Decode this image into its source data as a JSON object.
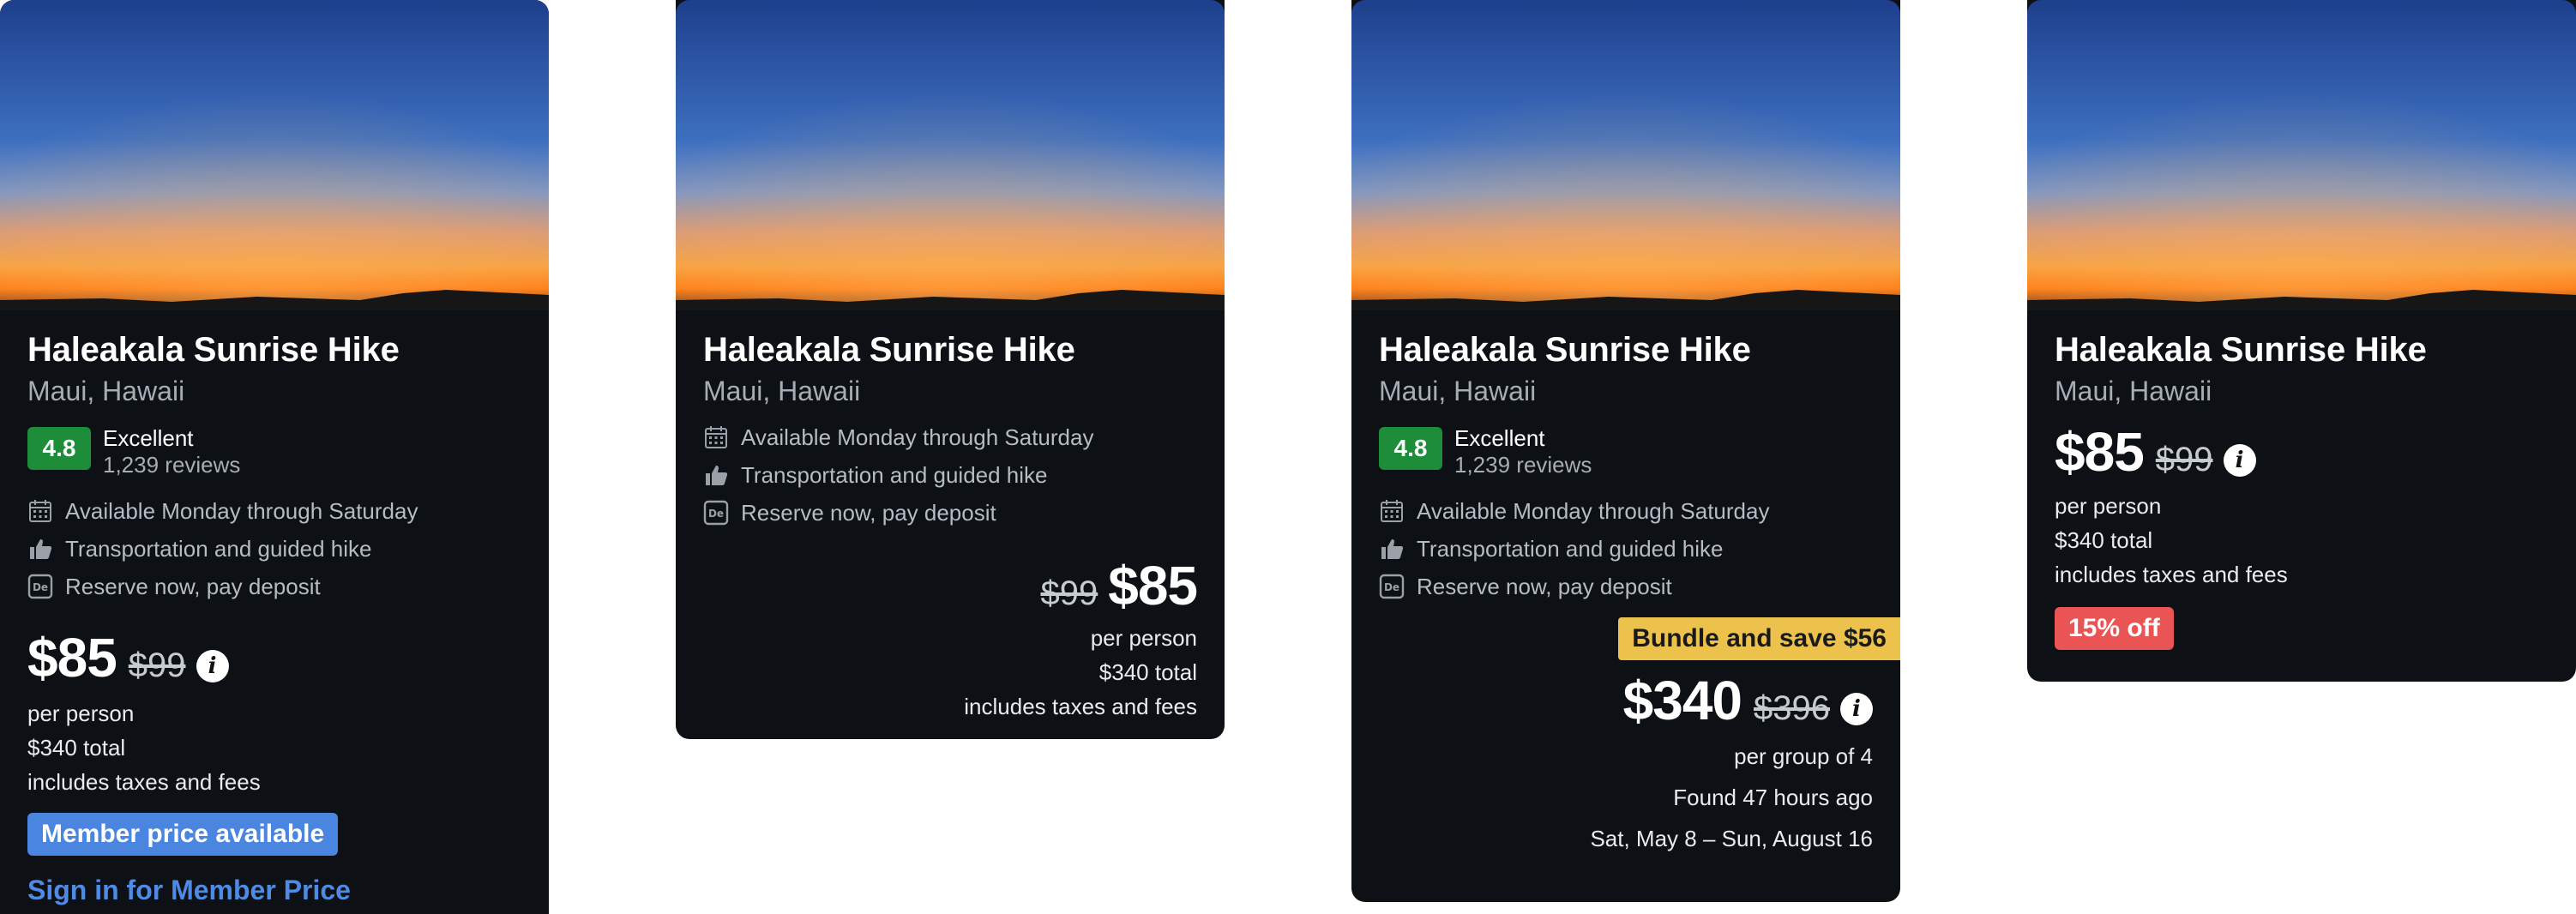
{
  "cards": [
    {
      "title": "Haleakala Sunrise Hike",
      "location": "Maui, Hawaii",
      "rating": {
        "score": "4.8",
        "label": "Excellent",
        "reviews": "1,239 reviews"
      },
      "features": [
        {
          "icon": "calendar-icon",
          "text": "Available Monday through Saturday"
        },
        {
          "icon": "thumbs-up-icon",
          "text": "Transportation and guided hike"
        },
        {
          "icon": "deposit-icon",
          "text": "Reserve now, pay deposit"
        }
      ],
      "price": "$85",
      "original_price": "$99",
      "price_lines": [
        "per person",
        "$340 total",
        "includes taxes and fees"
      ],
      "member_badge": "Member price available",
      "member_link": "Sign in for Member Price"
    },
    {
      "title": "Haleakala Sunrise Hike",
      "location": "Maui, Hawaii",
      "features": [
        {
          "icon": "calendar-icon",
          "text": "Available Monday through Saturday"
        },
        {
          "icon": "thumbs-up-icon",
          "text": "Transportation and guided hike"
        },
        {
          "icon": "deposit-icon",
          "text": "Reserve now, pay deposit"
        }
      ],
      "price": "$85",
      "original_price": "$99",
      "price_lines": [
        "per person",
        "$340 total",
        "includes taxes and fees"
      ]
    },
    {
      "title": "Haleakala Sunrise Hike",
      "location": "Maui, Hawaii",
      "rating": {
        "score": "4.8",
        "label": "Excellent",
        "reviews": "1,239 reviews"
      },
      "features": [
        {
          "icon": "calendar-icon",
          "text": "Available Monday through Saturday"
        },
        {
          "icon": "thumbs-up-icon",
          "text": "Transportation and guided hike"
        },
        {
          "icon": "deposit-icon",
          "text": "Reserve now, pay deposit"
        }
      ],
      "bundle_badge": "Bundle and save $56",
      "price": "$340",
      "original_price": "$396",
      "price_lines": [
        "per group of 4",
        "Found 47 hours ago",
        "Sat, May 8 – Sun, August 16"
      ]
    },
    {
      "title": "Haleakala Sunrise Hike",
      "location": "Maui, Hawaii",
      "price": "$85",
      "original_price": "$99",
      "price_lines": [
        "per person",
        "$340 total",
        "includes taxes and fees"
      ],
      "discount_badge": "15% off"
    }
  ],
  "colors": {
    "card_bg": "#0d1014",
    "rating_green": "#1e8d3a",
    "member_blue": "#4a86e0",
    "bundle_yellow": "#ecc24c",
    "discount_red": "#ea5455"
  }
}
